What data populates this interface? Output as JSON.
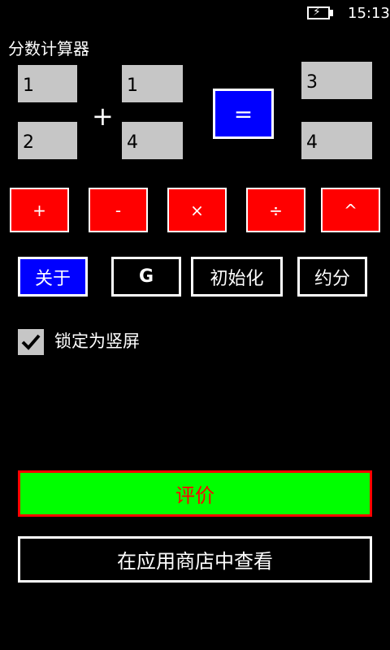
{
  "status_bar": {
    "time": "15:13",
    "battery_icon": "battery-charging-icon"
  },
  "app": {
    "title": "分数计算器"
  },
  "fraction_a": {
    "numerator": "1",
    "denominator": "2"
  },
  "operator_display": "+",
  "fraction_b": {
    "numerator": "1",
    "denominator": "4"
  },
  "equals_label": "=",
  "result": {
    "numerator": "3",
    "denominator": "4"
  },
  "operators": [
    {
      "label": "+"
    },
    {
      "label": "-"
    },
    {
      "label": "×"
    },
    {
      "label": "÷"
    },
    {
      "label": "^"
    }
  ],
  "actions": {
    "about": "关于",
    "g": "G",
    "init": "初始化",
    "reduce": "约分"
  },
  "lock_portrait": {
    "label": "锁定为竖屏",
    "checked": true
  },
  "rate_label": "评价",
  "store_label": "在应用商店中查看",
  "colors": {
    "background": "#000000",
    "input_bg": "#c6c6c6",
    "equals_bg": "#0000ff",
    "operator_bg": "#ff0000",
    "rate_bg": "#00ff00",
    "rate_text": "#ff0000"
  }
}
